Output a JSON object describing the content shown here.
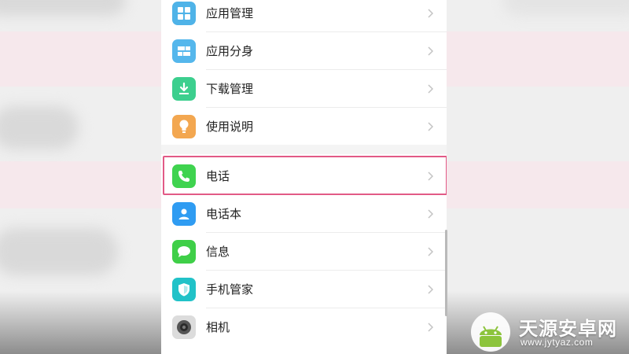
{
  "settings_list": {
    "group_1": [
      {
        "label": "应用管理",
        "icon": "grid-icon",
        "color": "#4fb3e8"
      },
      {
        "label": "应用分身",
        "icon": "app-clone-icon",
        "color": "#55b7ec"
      },
      {
        "label": "下载管理",
        "icon": "download-icon",
        "color": "#3ccf8e"
      },
      {
        "label": "使用说明",
        "icon": "lightbulb-icon",
        "color": "#f3a750"
      }
    ],
    "group_2": [
      {
        "label": "电话",
        "icon": "phone-icon",
        "color": "#3fd34f"
      },
      {
        "label": "电话本",
        "icon": "contacts-icon",
        "color": "#2f9cf2"
      },
      {
        "label": "信息",
        "icon": "message-icon",
        "color": "#3fcf48"
      },
      {
        "label": "手机管家",
        "icon": "shield-icon",
        "color": "#21c2c8"
      },
      {
        "label": "相机",
        "icon": "camera-icon",
        "color": "#555555"
      }
    ],
    "highlight_color": "#e25a86"
  },
  "watermark": {
    "title": "天源安卓网",
    "url": "www.jytyaz.com"
  }
}
